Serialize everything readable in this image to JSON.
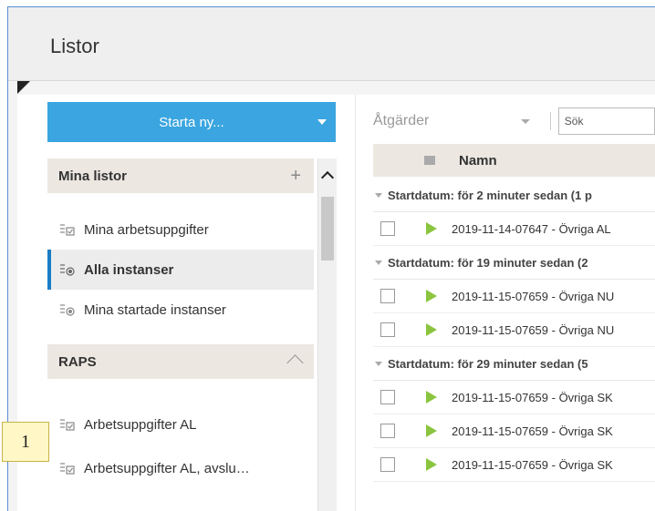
{
  "window": {
    "title": "Listor"
  },
  "left": {
    "start_button": "Starta ny...",
    "sections": [
      {
        "title": "Mina listor",
        "action": "+"
      },
      {
        "title": "RAPS"
      }
    ],
    "my_lists": [
      {
        "label": "Mina arbetsuppgifter",
        "icon": "task-list-icon"
      },
      {
        "label": "Alla instanser",
        "icon": "instance-list-icon",
        "active": true
      },
      {
        "label": "Mina startade instanser",
        "icon": "instance-list-icon"
      }
    ],
    "raps_lists": [
      {
        "label": "Arbetsuppgifter AL",
        "icon": "task-list-icon"
      },
      {
        "label": "Arbetsuppgifter AL, avslu…",
        "icon": "task-list-icon"
      }
    ]
  },
  "right": {
    "actions_placeholder": "Åtgärder",
    "search_placeholder": "Sök",
    "column_name": "Namn",
    "groups": [
      {
        "label": "Startdatum: för 2 minuter sedan (1 p",
        "rows": [
          "2019-11-14-07647 - Övriga AL"
        ]
      },
      {
        "label": "Startdatum: för 19 minuter sedan (2",
        "rows": [
          "2019-11-15-07659 - Övriga NU",
          "2019-11-15-07659 - Övriga NU"
        ]
      },
      {
        "label": "Startdatum: för 29 minuter sedan (5",
        "rows": [
          "2019-11-15-07659 - Övriga SK",
          "2019-11-15-07659 - Övriga SK",
          "2019-11-15-07659 - Övriga SK"
        ]
      }
    ]
  },
  "badge": "1",
  "colors": {
    "accent": "#3aa5e0",
    "active_border": "#1a7cc4",
    "play": "#8bc53f"
  }
}
